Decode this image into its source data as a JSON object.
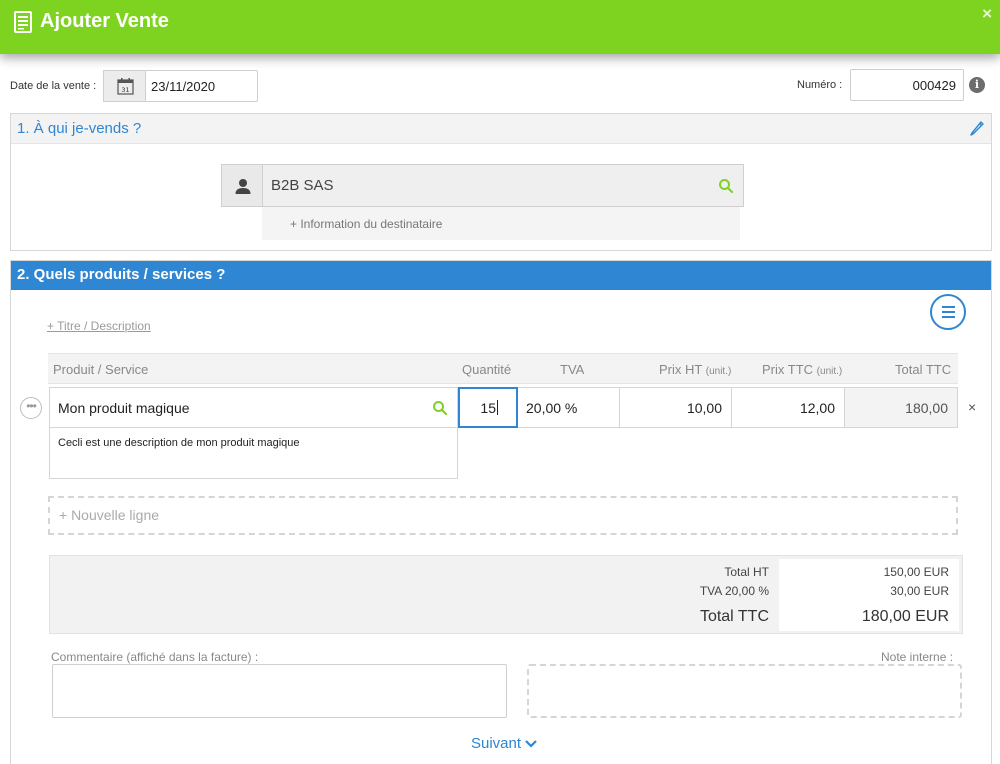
{
  "header": {
    "title": "Ajouter Vente",
    "close": "×"
  },
  "sale": {
    "date_label": "Date de la vente :",
    "date_value": "23/11/2020",
    "calendar_day": "31",
    "number_label": "Numéro :",
    "number_value": "000429",
    "info": "i"
  },
  "section1": {
    "title": "1. À qui je-vends ?",
    "client_value": "B2B SAS",
    "recipient_info_link": "+ Information du destinataire"
  },
  "section2": {
    "title": "2. Quels produits / services ?",
    "title_description_link": "+ Titre / Description",
    "columns": {
      "product": "Produit / Service",
      "quantity": "Quantité",
      "tva": "TVA",
      "price_ht": "Prix HT",
      "price_ttc": "Prix TTC",
      "unit_suffix": "(unit.)",
      "total_ttc": "Total TTC"
    },
    "row": {
      "dots": "•••",
      "product": "Mon produit magique",
      "description": "Cecli est une description de mon produit magique",
      "quantity": "15",
      "tva": "20,00 %",
      "price_ht": "10,00",
      "price_ttc": "12,00",
      "total": "180,00",
      "delete": "×"
    },
    "new_line": "+ Nouvelle ligne"
  },
  "totals": {
    "total_ht_label": "Total HT",
    "total_ht_value": "150,00 EUR",
    "tva_label": "TVA 20,00 %",
    "tva_value": "30,00 EUR",
    "total_ttc_label": "Total TTC",
    "total_ttc_value": "180,00 EUR"
  },
  "comment_label": "Commentaire (affiché dans la facture) :",
  "internal_note_label": "Note interne :",
  "next_label": "Suivant",
  "colors": {
    "green": "#7ed321",
    "blue": "#2f86d2"
  }
}
